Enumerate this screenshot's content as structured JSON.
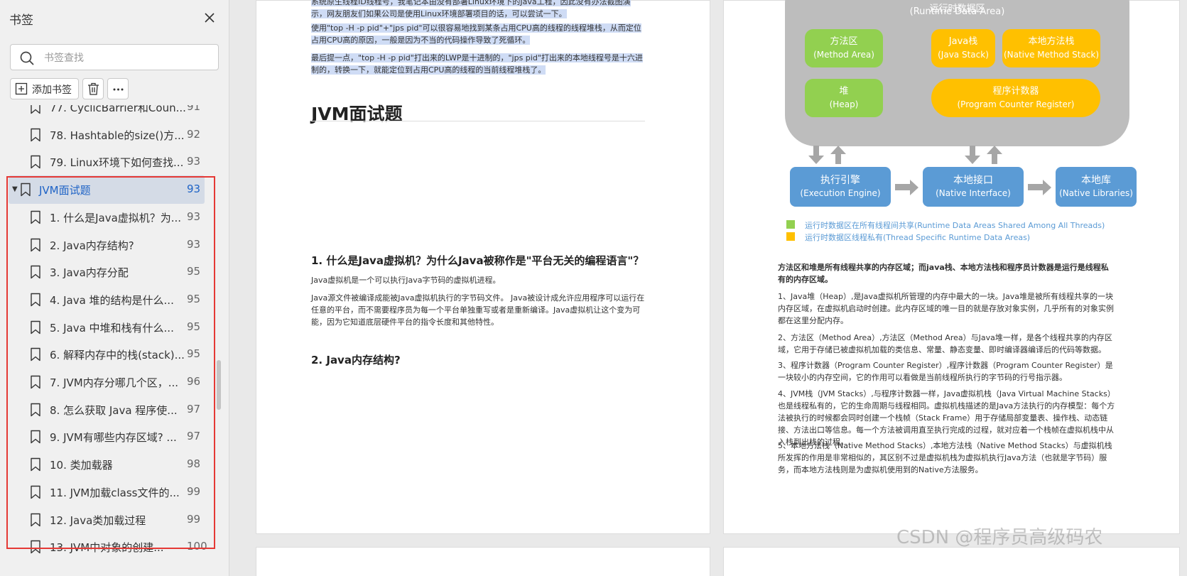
{
  "sidebar": {
    "title": "书签",
    "search_placeholder": "书签查找",
    "add_label": "添加书签",
    "items": [
      {
        "title": "77. CyclicBarrier和Coun...",
        "page": "91"
      },
      {
        "title": "78. Hashtable的size()方...",
        "page": "92"
      },
      {
        "title": "79. Linux环境下如何查找...",
        "page": "93"
      },
      {
        "title": "JVM面试题",
        "page": "93"
      },
      {
        "title": "1. 什么是Java虚拟机？为...",
        "page": "93"
      },
      {
        "title": "2. Java内存结构?",
        "page": "93"
      },
      {
        "title": "3. Java内存分配",
        "page": "95"
      },
      {
        "title": "4. Java 堆的结构是什么...",
        "page": "95"
      },
      {
        "title": "5. Java 中堆和栈有什么...",
        "page": "95"
      },
      {
        "title": "6. 解释内存中的栈(stack)...",
        "page": "95"
      },
      {
        "title": "7. JVM内存分哪几个区，...",
        "page": "96"
      },
      {
        "title": "8. 怎么获取 Java 程序使...",
        "page": "97"
      },
      {
        "title": "9. JVM有哪些内存区域? ...",
        "page": "97"
      },
      {
        "title": "10. 类加载器",
        "page": "98"
      },
      {
        "title": "11. JVM加载class文件的...",
        "page": "99"
      },
      {
        "title": "12. Java类加载过程",
        "page": "99"
      },
      {
        "title": "13. JVM中对象的创建...",
        "page": "100"
      }
    ]
  },
  "page1": {
    "top_para_1": "系统原生线程ID线程号，我笔记本由没有部署Linux环境下的Java工程，因此没有办法截图演示，网友朋友们如果公司是使用Linux环境部署项目的话，可以尝试一下。",
    "top_para_2": "使用\"top -H -p pid\"+\"jps pid\"可以很容易地找到某条占用CPU高的线程的线程堆栈，从而定位占用CPU高的原因，一般是因为不当的代码操作导致了死循环。",
    "top_para_3": "最后提一点，\"top -H -p pid\"打出来的LWP是十进制的，\"jps pid\"打出来的本地线程号是十六进制的，转换一下，就能定位到占用CPU高的线程的当前线程堆栈了。",
    "heading": "JVM面试题",
    "q1_title": "1. 什么是Java虚拟机？为什么Java被称作是\"平台无关的编程语言\"？",
    "q1_p1": "Java虚拟机是一个可以执行Java字节码的虚拟机进程。",
    "q1_p2": "Java源文件被编译成能被Java虚拟机执行的字节码文件。 Java被设计成允许应用程序可以运行在任意的平台，而不需要程序员为每一个平台单独重写或者是重新编译。Java虚拟机让这个变为可能，因为它知道底层硬件平台的指令长度和其他特性。",
    "q2_title": "2. Java内存结构?"
  },
  "diagram": {
    "area_title": "运行时数据区",
    "area_title_en": "(Runtime Data Area)",
    "method_area": "方法区",
    "method_area_en": "(Method Area)",
    "heap": "堆",
    "heap_en": "(Heap)",
    "java_stack": "Java栈",
    "java_stack_en": "(Java Stack)",
    "native_stack": "本地方法栈",
    "native_stack_en": "(Native Method Stack)",
    "pc": "程序计数器",
    "pc_en": "(Program Counter Register)",
    "engine": "执行引擎",
    "engine_en": "(Execution Engine)",
    "native_if": "本地接口",
    "native_if_en": "(Native Interface)",
    "native_lib": "本地库",
    "native_lib_en": "(Native Libraries)",
    "legend_shared": "运行时数据区在所有线程间共享(Runtime Data Areas Shared Among All Threads)",
    "legend_private": "运行时数据区线程私有(Thread Specific Runtime Data Areas)",
    "colors": {
      "shared": "#92d050",
      "private": "#ffc000",
      "exec": "#5b9bd5",
      "area": "#bdbdbd"
    }
  },
  "page2": {
    "summary": "方法区和堆是所有线程共享的内存区域；而java栈、本地方法栈和程序员计数器是运行是线程私有的内存区域。",
    "p1": "1、Java堆（Heap）,是Java虚拟机所管理的内存中最大的一块。Java堆是被所有线程共享的一块内存区域，在虚拟机启动时创建。此内存区域的唯一目的就是存放对象实例，几乎所有的对象实例都在这里分配内存。",
    "p2": "2、方法区（Method Area）,方法区（Method Area）与Java堆一样，是各个线程共享的内存区域，它用于存储已被虚拟机加载的类信息、常量、静态变量、即时编译器编译后的代码等数据。",
    "p3": "3、程序计数器（Program Counter Register）,程序计数器（Program Counter Register）是一块较小的内存空间，它的作用可以看做是当前线程所执行的字节码的行号指示器。",
    "p4": "4、JVM栈（JVM Stacks）,与程序计数器一样，Java虚拟机栈（Java Virtual Machine Stacks）也是线程私有的，它的生命周期与线程相同。虚拟机栈描述的是Java方法执行的内存模型：每个方法被执行的时候都会同时创建一个栈帧（Stack Frame）用于存储局部变量表、操作栈、动态链接、方法出口等信息。每一个方法被调用直至执行完成的过程，就对应着一个栈帧在虚拟机栈中从入栈到出栈的过程。",
    "p5": "5、本地方法栈（Native Method Stacks）,本地方法栈（Native Method Stacks）与虚拟机栈所发挥的作用是非常相似的，其区别不过是虚拟机栈为虚拟机执行Java方法（也就是字节码）服务，而本地方法栈则是为虚拟机使用到的Native方法服务。"
  },
  "watermark": "CSDN @程序员高级码农"
}
